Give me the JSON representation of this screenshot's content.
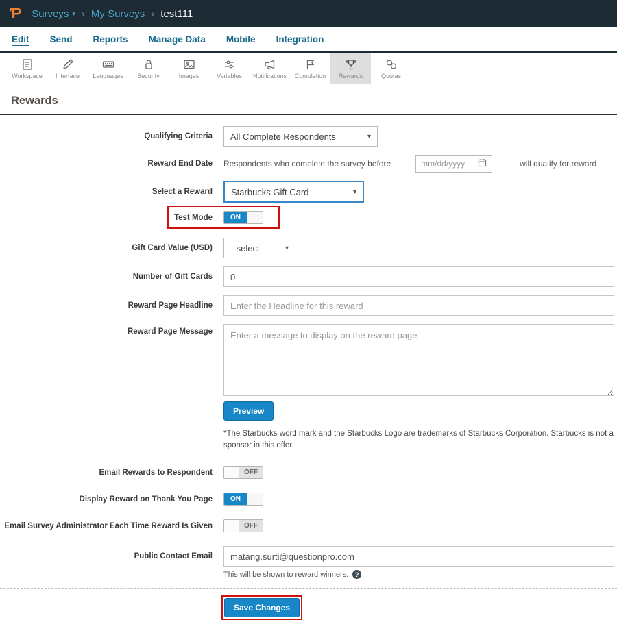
{
  "header": {
    "logo": "Ƥ",
    "breadcrumb": {
      "surveys": "Surveys",
      "my_surveys": "My Surveys",
      "current": "test111"
    }
  },
  "icons": {
    "caret_down": "▾",
    "breadcrumb_separator": "›",
    "help": "?"
  },
  "menu": {
    "items": [
      "Edit",
      "Send",
      "Reports",
      "Manage Data",
      "Mobile",
      "Integration"
    ],
    "active": "Edit"
  },
  "toolbar": {
    "items": [
      {
        "label": "Workspace"
      },
      {
        "label": "Interface"
      },
      {
        "label": "Languages"
      },
      {
        "label": "Security"
      },
      {
        "label": "Images"
      },
      {
        "label": "Variables"
      },
      {
        "label": "Notifications"
      },
      {
        "label": "Completion"
      },
      {
        "label": "Rewards"
      },
      {
        "label": "Quotas"
      }
    ],
    "active": "Rewards"
  },
  "page": {
    "title": "Rewards"
  },
  "form": {
    "qualifying_criteria": {
      "label": "Qualifying Criteria",
      "value": "All Complete Respondents"
    },
    "reward_end_date": {
      "label": "Reward End Date",
      "prefix": "Respondents who complete the survey before",
      "placeholder": "mm/dd/yyyy",
      "suffix": "will qualify for reward"
    },
    "select_reward": {
      "label": "Select a Reward",
      "value": "Starbucks Gift Card"
    },
    "test_mode": {
      "label": "Test Mode",
      "state": "ON"
    },
    "gift_card_value": {
      "label": "Gift Card Value (USD)",
      "value": "--select--"
    },
    "number_of_gift_cards": {
      "label": "Number of Gift Cards",
      "value": "0"
    },
    "reward_page_headline": {
      "label": "Reward Page Headline",
      "placeholder": "Enter the Headline for this reward"
    },
    "reward_page_message": {
      "label": "Reward Page Message",
      "placeholder": "Enter a message to display on the reward page"
    },
    "preview_button": "Preview",
    "disclaimer": "*The Starbucks word mark and the Starbucks Logo are trademarks of Starbucks Corporation. Starbucks is not a sponsor in this offer.",
    "email_rewards_to_respondent": {
      "label": "Email Rewards to Respondent",
      "state": "OFF"
    },
    "display_reward_on_thank_you_page": {
      "label": "Display Reward on Thank You Page",
      "state": "ON"
    },
    "email_survey_administrator": {
      "label": "Email Survey Administrator Each Time Reward Is Given",
      "state": "OFF"
    },
    "public_contact_email": {
      "label": "Public Contact Email",
      "value": "matang.surti@questionpro.com",
      "help": "This will be shown to reward winners."
    },
    "save_button": "Save Changes"
  },
  "colors": {
    "header_bg": "#1d2b35",
    "accent_blue": "#1787c7",
    "link_blue": "#4da7ca",
    "highlight_red": "#cc1111"
  }
}
